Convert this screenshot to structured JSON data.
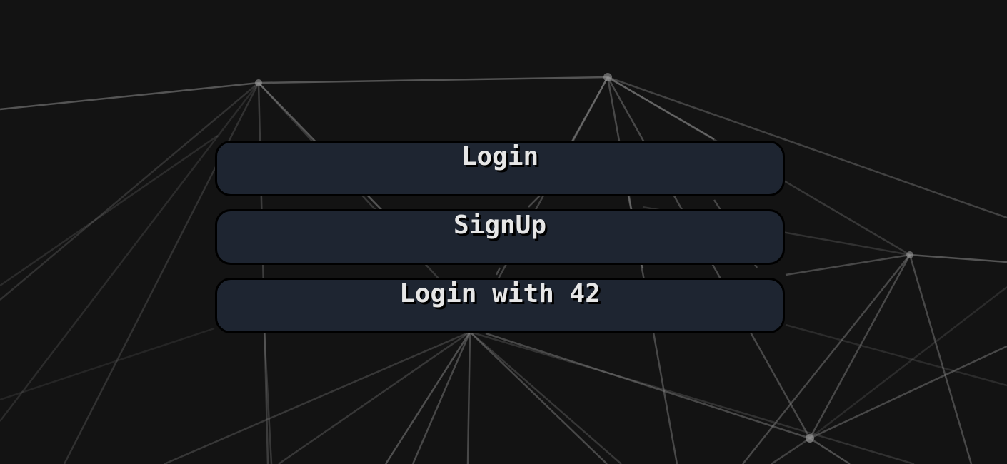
{
  "menu": {
    "login_label": "Login",
    "signup_label": "SignUp",
    "login42_label": "Login with 42"
  },
  "colors": {
    "background": "#131313",
    "button_fill": "#1e2531",
    "button_border": "#000000",
    "button_text": "#e6e6e6",
    "network_line": "#8a8a8a"
  }
}
